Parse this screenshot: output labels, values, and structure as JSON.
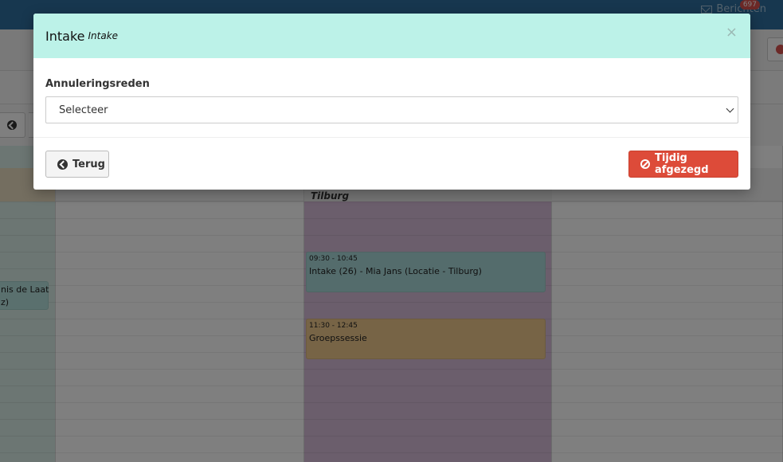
{
  "topbar": {
    "messages_label": "Berichten",
    "messages_badge": "697"
  },
  "calendar": {
    "location_title": "Tilburg",
    "events": [
      {
        "time": "09:30 - 10:45",
        "title": "Intake (26) - Mia Jans (Locatie - Tilburg)"
      },
      {
        "time": "11:30 - 12:45",
        "title": "Groepssessie"
      }
    ],
    "left_event": {
      "line1": "nis de Laat",
      "line2": "z)"
    }
  },
  "modal": {
    "title": "Intake",
    "subtitle": "Intake",
    "close_label": "×",
    "field_label": "Annuleringsreden",
    "select_value": "Selecteer",
    "back_button": "Terug",
    "cancel_button": "Tijdig afgezegd"
  },
  "colors": {
    "topbar": "#2e6f9e",
    "modal_header": "#bcf2e8",
    "danger": "#dd4b39",
    "event_intake": "#a9d9d8",
    "event_group": "#efc98c",
    "column_location": "#d6bcd9"
  },
  "icons": [
    "envelope-icon",
    "arrow-circle-left-icon",
    "ban-icon",
    "close-icon",
    "chevron-down-icon"
  ]
}
